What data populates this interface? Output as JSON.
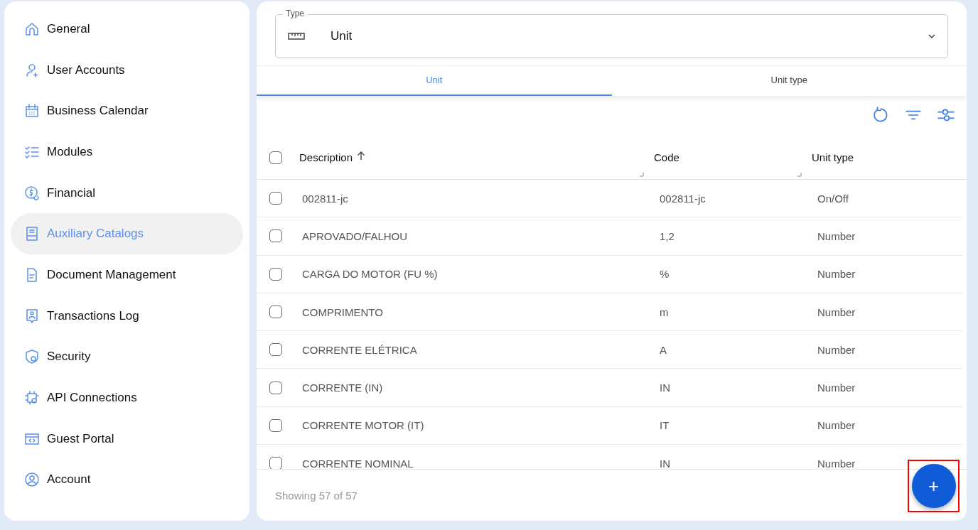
{
  "sidebar": {
    "items": [
      {
        "label": "General",
        "selected": false
      },
      {
        "label": "User Accounts",
        "selected": false
      },
      {
        "label": "Business Calendar",
        "selected": false
      },
      {
        "label": "Modules",
        "selected": false
      },
      {
        "label": "Financial",
        "selected": false
      },
      {
        "label": "Auxiliary Catalogs",
        "selected": true
      },
      {
        "label": "Document Management",
        "selected": false
      },
      {
        "label": "Transactions Log",
        "selected": false
      },
      {
        "label": "Security",
        "selected": false
      },
      {
        "label": "API Connections",
        "selected": false
      },
      {
        "label": "Guest Portal",
        "selected": false
      },
      {
        "label": "Account",
        "selected": false
      }
    ]
  },
  "type_field": {
    "label": "Type",
    "value": "Unit"
  },
  "tabs": [
    {
      "label": "Unit",
      "selected": true
    },
    {
      "label": "Unit type",
      "selected": false
    }
  ],
  "table": {
    "all_checked": false,
    "columns": [
      {
        "label": "Description",
        "sorted": true
      },
      {
        "label": "Code",
        "sorted": false
      },
      {
        "label": "Unit type",
        "sorted": false
      }
    ],
    "rows": [
      {
        "cells": [
          "002811-jc",
          "002811-jc",
          "On/Off"
        ],
        "checked": false
      },
      {
        "cells": [
          "APROVADO/FALHOU",
          "1,2",
          "Number"
        ],
        "checked": false
      },
      {
        "cells": [
          "CARGA DO MOTOR (FU %)",
          "%",
          "Number"
        ],
        "checked": false
      },
      {
        "cells": [
          "COMPRIMENTO",
          "m",
          "Number"
        ],
        "checked": false
      },
      {
        "cells": [
          "CORRENTE ELÉTRICA",
          "A",
          "Number"
        ],
        "checked": false
      },
      {
        "cells": [
          "CORRENTE (IN)",
          "IN",
          "Number"
        ],
        "checked": false
      },
      {
        "cells": [
          "CORRENTE MOTOR (IT)",
          "IT",
          "Number"
        ],
        "checked": false
      },
      {
        "cells": [
          "CORRENTE NOMINAL",
          "IN",
          "Number"
        ],
        "checked": false
      }
    ]
  },
  "status": "Showing 57 of 57",
  "add_button": {
    "label": "+",
    "highlighted": true
  }
}
